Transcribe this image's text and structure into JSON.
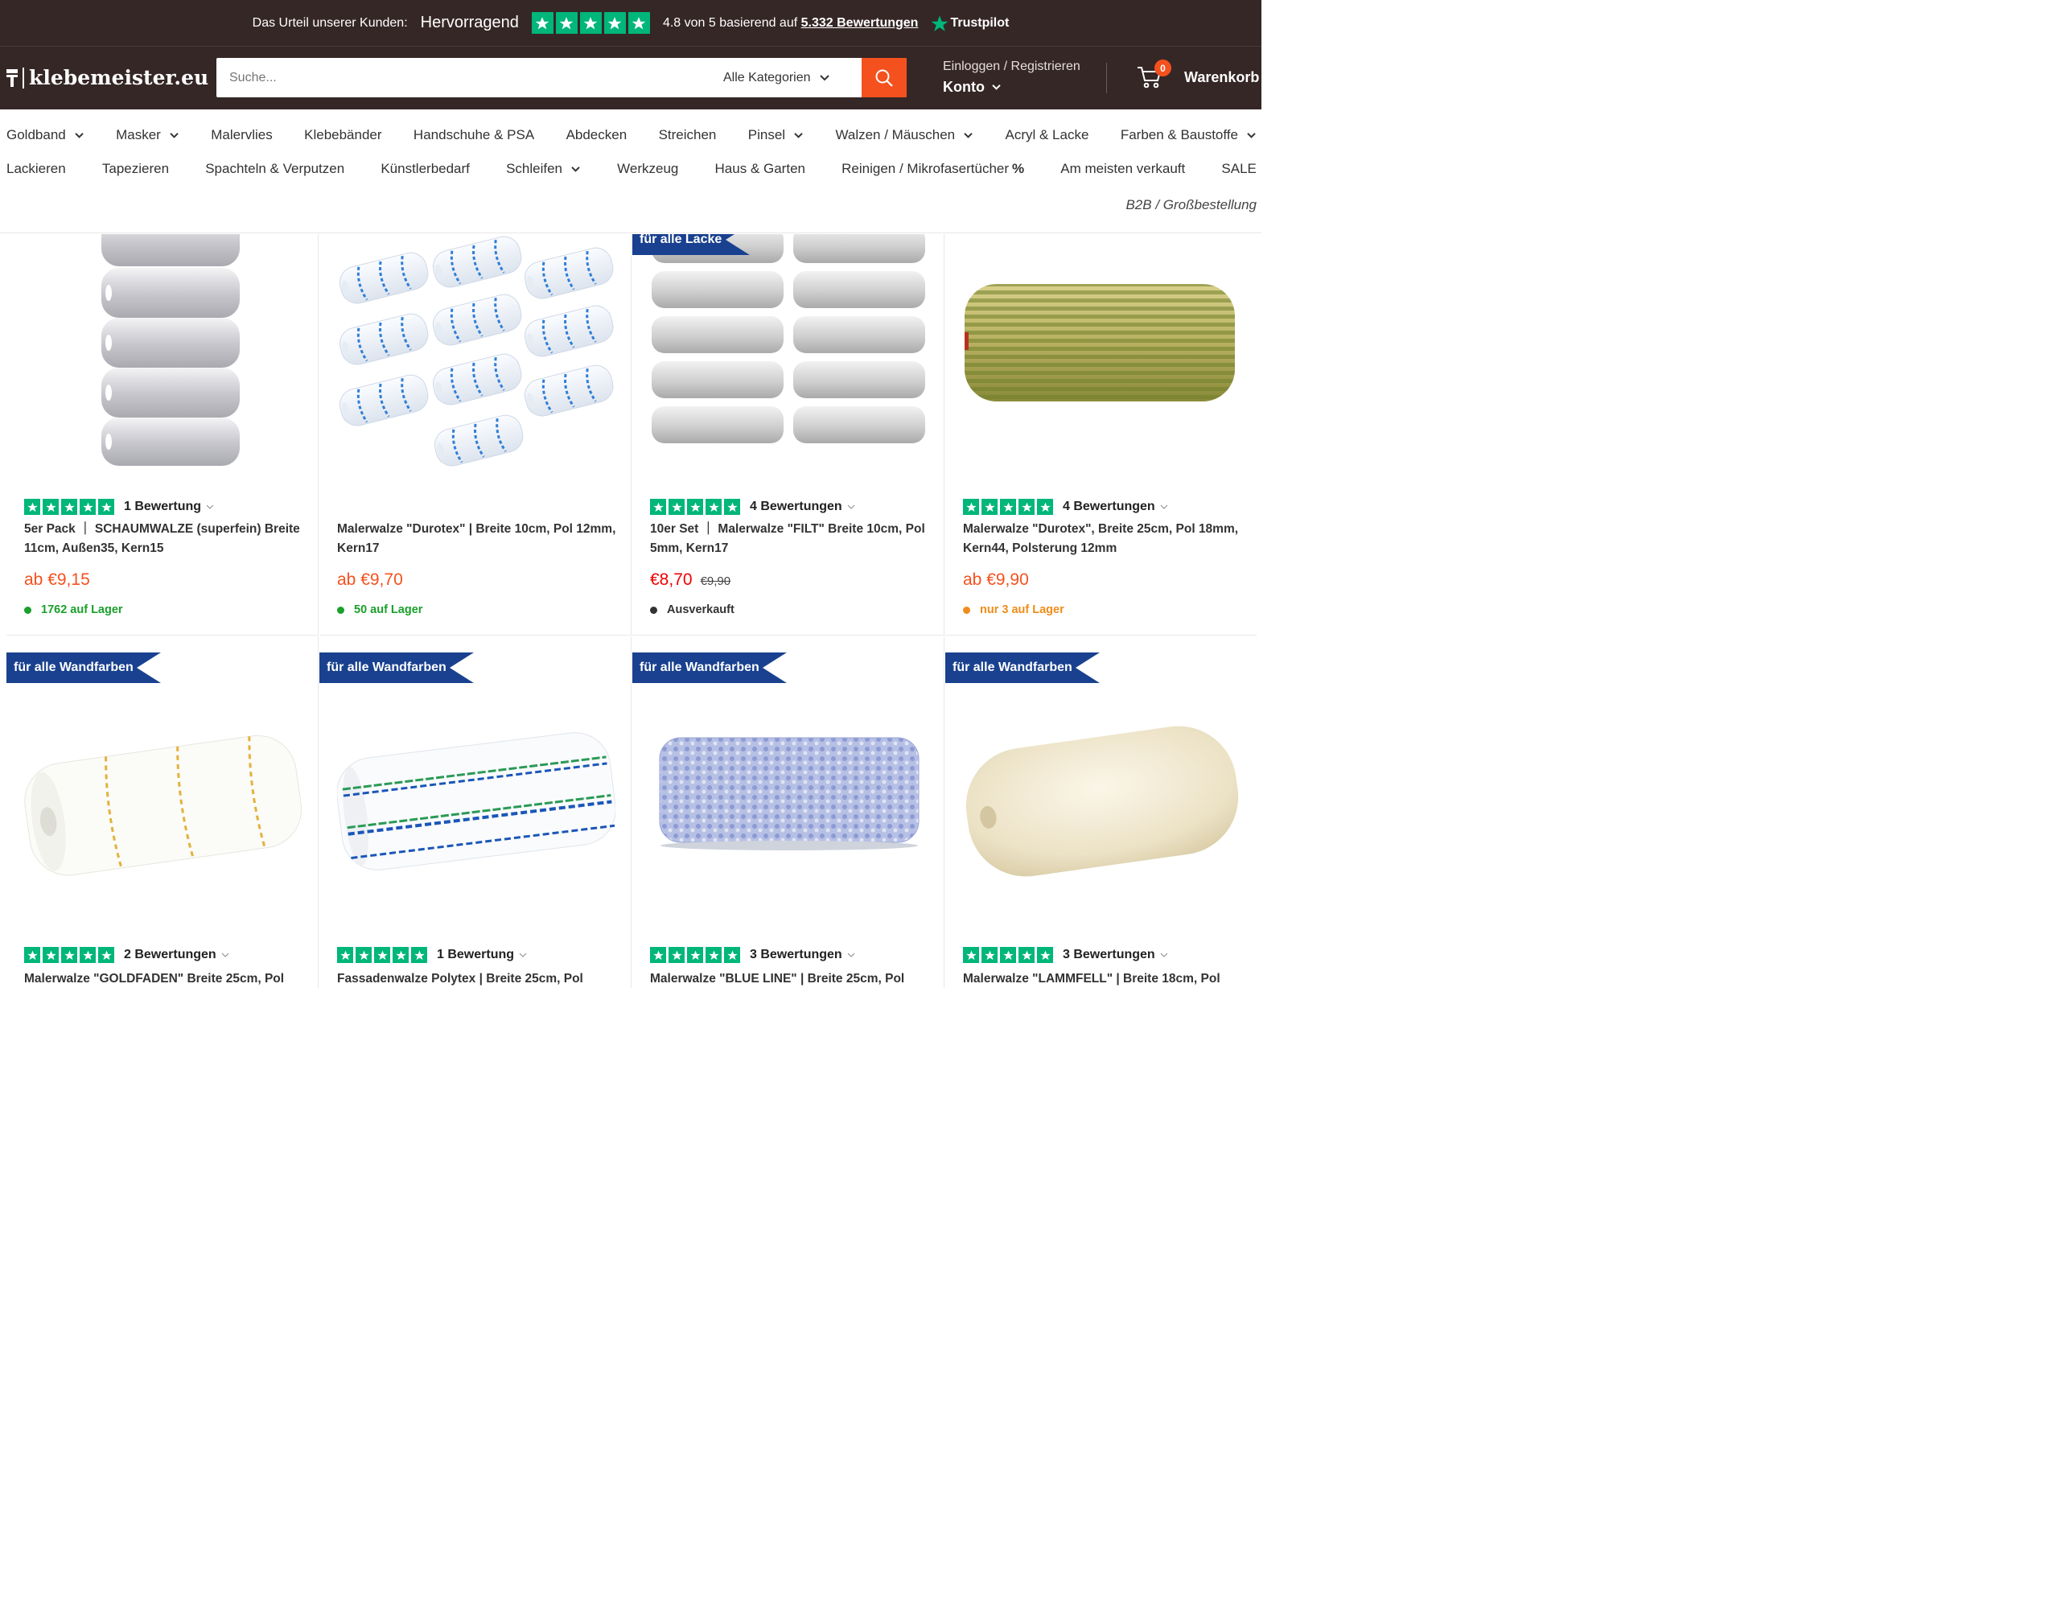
{
  "trust": {
    "lead": "Das Urteil unserer Kunden:",
    "word": "Hervorragend",
    "score_prefix": "4.8 von 5 basierend auf",
    "count_link": "5.332 Bewertungen",
    "brand": "Trustpilot"
  },
  "header": {
    "logo": "klebemeister.eu",
    "search_placeholder": "Suche...",
    "category": "Alle Kategorien",
    "account_top": "Einloggen / Registrieren",
    "account_label": "Konto",
    "cart_label": "Warenkorb",
    "cart_count": "0"
  },
  "nav_row1": [
    {
      "label": "Goldband",
      "chev": true
    },
    {
      "label": "Masker",
      "chev": true
    },
    {
      "label": "Malervlies",
      "chev": false
    },
    {
      "label": "Klebebänder",
      "chev": false
    },
    {
      "label": "Handschuhe & PSA",
      "chev": false
    },
    {
      "label": "Abdecken",
      "chev": false
    },
    {
      "label": "Streichen",
      "chev": false
    },
    {
      "label": "Pinsel",
      "chev": true
    },
    {
      "label": "Walzen / Mäuschen",
      "chev": true
    },
    {
      "label": "Acryl & Lacke",
      "chev": false
    },
    {
      "label": "Farben & Baustoffe",
      "chev": true
    }
  ],
  "nav_row2": [
    {
      "label": "Lackieren",
      "chev": false
    },
    {
      "label": "Tapezieren",
      "chev": false
    },
    {
      "label": "Spachteln & Verputzen",
      "chev": false
    },
    {
      "label": "Künstlerbedarf",
      "chev": false
    },
    {
      "label": "Schleifen",
      "chev": true
    },
    {
      "label": "Werkzeug",
      "chev": false
    },
    {
      "label": "Haus & Garten",
      "chev": false
    },
    {
      "label": "Reinigen / Mikrofasertücher",
      "chev": false,
      "percent": true
    },
    {
      "label": "Am meisten verkauft",
      "chev": false
    },
    {
      "label": "SALE",
      "chev": false
    }
  ],
  "nav_b2b": "B2B / Großbestellung",
  "products_row1": [
    {
      "ribbon": "",
      "rating": "1 Bewertung",
      "title": "5er Pack ｜ SCHAUMWALZE (superfein) Breite 11cm, Außen35, Kern15",
      "price": "ab €9,15",
      "old_price": "",
      "stock": "1762 auf Lager",
      "stock_color": "#1aa02b",
      "image": "foam-roller-5pack"
    },
    {
      "ribbon": "",
      "rating": "",
      "title": "Malerwalze \"Durotex\" | Breite 10cm, Pol 12mm, Kern17",
      "price": "ab €9,70",
      "old_price": "",
      "stock": "50 auf Lager",
      "stock_color": "#1aa02b",
      "image": "blue-striped-rollers-10pack"
    },
    {
      "ribbon": "für alle Lacke",
      "rating": "4 Bewertungen",
      "title": "10er Set ｜ Malerwalze \"FILT\" Breite 10cm, Pol 5mm, Kern17",
      "price": "€8,70",
      "old_price": "€9,90",
      "stock": "Ausverkauft",
      "stock_color": "#333333",
      "image": "grey-felt-rollers-10pack"
    },
    {
      "ribbon": "",
      "rating": "4 Bewertungen",
      "title": "Malerwalze \"Durotex\", Breite 25cm, Pol 18mm, Kern44, Polsterung 12mm",
      "price": "ab €9,90",
      "old_price": "",
      "stock": "nur 3 auf Lager",
      "stock_color": "#f08c1a",
      "image": "yellow-green-roller"
    }
  ],
  "products_row2": [
    {
      "ribbon": "für alle Wandfarben",
      "rating": "2 Bewertungen",
      "title": "Malerwalze \"GOLDFADEN\" Breite 25cm, Pol",
      "image": "gold-thread-roller"
    },
    {
      "ribbon": "für alle Wandfarben",
      "rating": "1 Bewertung",
      "title": "Fassadenwalze Polytex | Breite 25cm, Pol",
      "image": "blue-green-stripe-roller"
    },
    {
      "ribbon": "für alle Wandfarben",
      "rating": "3 Bewertungen",
      "title": "Malerwalze \"BLUE LINE\" | Breite 25cm, Pol",
      "image": "blue-line-roller"
    },
    {
      "ribbon": "für alle Wandfarben",
      "rating": "3 Bewertungen",
      "title": "Malerwalze \"LAMMFELL\" | Breite 18cm, Pol",
      "image": "lambskin-roller"
    }
  ],
  "colors": {
    "header_bg": "#352726",
    "accent": "#f4511e",
    "trustpilot": "#00b67a",
    "ribbon": "#19418f"
  }
}
